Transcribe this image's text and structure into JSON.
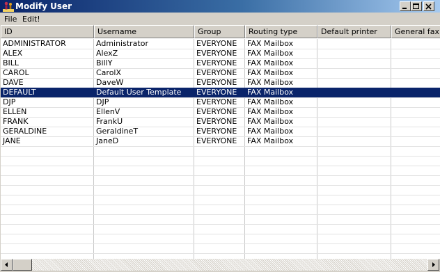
{
  "window": {
    "title": "Modify User",
    "app_icon": "user-figure-icon",
    "controls": [
      "minimize-icon",
      "maximize-icon",
      "close-icon"
    ]
  },
  "menu": {
    "file": "File",
    "edit": "Edit!"
  },
  "table": {
    "columns": [
      "ID",
      "Username",
      "Group",
      "Routing type",
      "Default printer",
      "General fax"
    ],
    "rows": [
      [
        "ADMINISTRATOR",
        "Administrator",
        "EVERYONE",
        "FAX Mailbox",
        "",
        ""
      ],
      [
        "ALEX",
        "AlexZ",
        "EVERYONE",
        "FAX Mailbox",
        "",
        ""
      ],
      [
        "BILL",
        "BillY",
        "EVERYONE",
        "FAX Mailbox",
        "",
        ""
      ],
      [
        "CAROL",
        "CarolX",
        "EVERYONE",
        "FAX Mailbox",
        "",
        ""
      ],
      [
        "DAVE",
        "DaveW",
        "EVERYONE",
        "FAX Mailbox",
        "",
        ""
      ],
      [
        "DEFAULT",
        "Default User Template",
        "EVERYONE",
        "FAX Mailbox",
        "",
        ""
      ],
      [
        "DJP",
        "DJP",
        "EVERYONE",
        "FAX Mailbox",
        "",
        ""
      ],
      [
        "ELLEN",
        "EllenV",
        "EVERYONE",
        "FAX Mailbox",
        "",
        ""
      ],
      [
        "FRANK",
        "FrankU",
        "EVERYONE",
        "FAX Mailbox",
        "",
        ""
      ],
      [
        "GERALDINE",
        "GeraldineT",
        "EVERYONE",
        "FAX Mailbox",
        "",
        ""
      ],
      [
        "JANE",
        "JaneD",
        "EVERYONE",
        "FAX Mailbox",
        "",
        ""
      ]
    ],
    "selected_row": 5
  },
  "colors": {
    "titlebar_start": "#0a246a",
    "selection": "#0a246a",
    "face": "#d4d0c8"
  }
}
